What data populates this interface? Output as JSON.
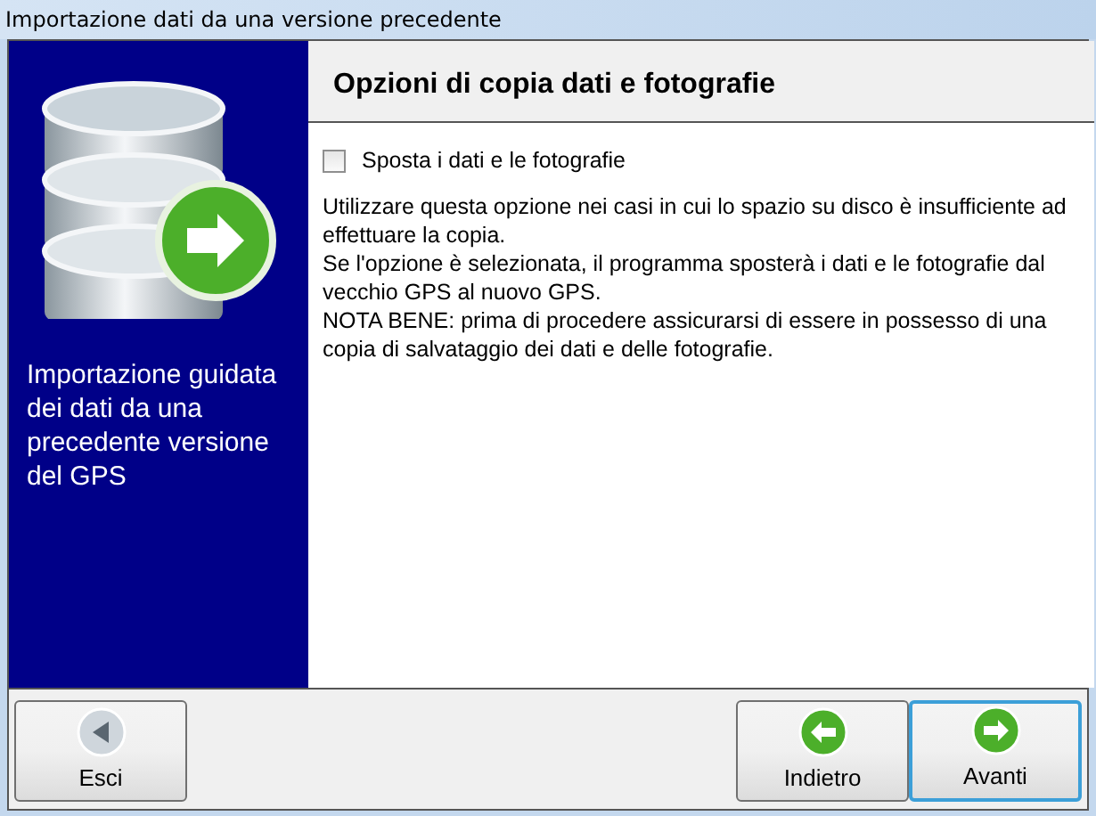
{
  "window": {
    "title": "Importazione dati da una versione precedente"
  },
  "sidebar": {
    "caption": "Importazione guidata dei dati da una precedente versione del GPS"
  },
  "header": {
    "title": "Opzioni di copia dati e fotografie"
  },
  "option": {
    "label": "Sposta i dati e le fotografie",
    "checked": false
  },
  "description": [
    "Utilizzare questa opzione nei casi in cui lo spazio su disco è insufficiente ad effettuare la copia.",
    "Se l'opzione è selezionata, il programma sposterà i dati e le fotografie dal vecchio GPS al nuovo GPS.",
    "NOTA BENE: prima di procedere assicurarsi di essere in possesso di una copia di salvataggio dei dati e delle fotografie."
  ],
  "buttons": [
    {
      "label": "Esci",
      "kind": "exit",
      "focused": false
    },
    {
      "label": "Indietro",
      "kind": "back",
      "focused": false
    },
    {
      "label": "Avanti",
      "kind": "next",
      "focused": true
    }
  ]
}
